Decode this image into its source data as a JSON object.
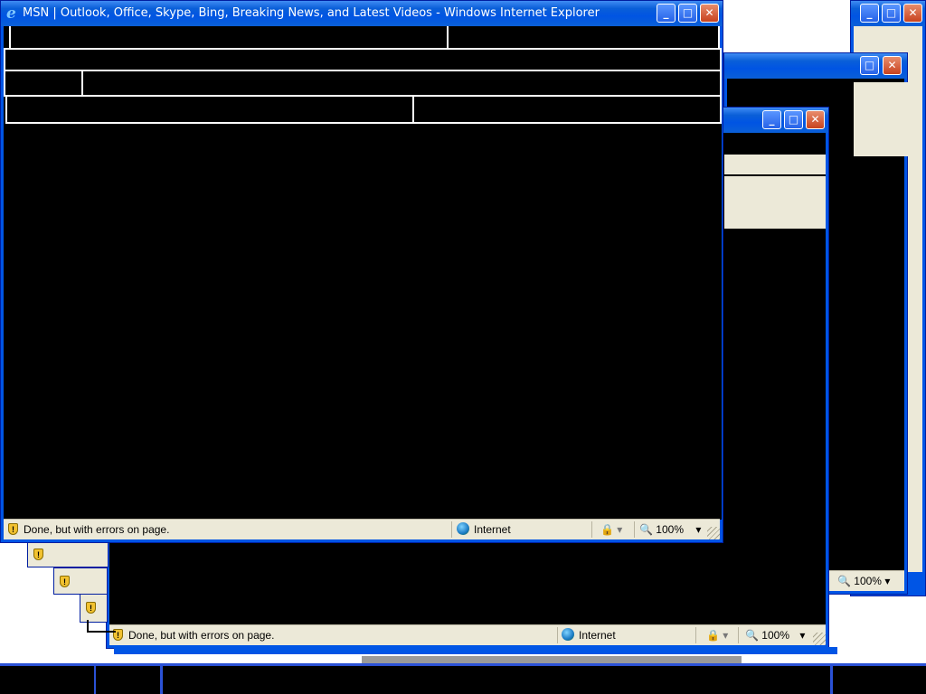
{
  "main_window": {
    "title": "MSN | Outlook, Office, Skype, Bing, Breaking News, and Latest Videos - Windows Internet Explorer",
    "buttons": {
      "minimize": "_",
      "maximize": "□",
      "close": "✕"
    },
    "status": {
      "message": "Done, but with errors on page.",
      "zone": "Internet",
      "zoom": "100%",
      "dropdown_arrow": "▾"
    }
  },
  "second_window": {
    "status": {
      "message": "Done, but with errors on page.",
      "zone": "Internet",
      "zoom": "100%",
      "dropdown_arrow": "▾"
    }
  },
  "back_window": {
    "status": {
      "zoom": "100%",
      "dropdown_arrow": "▾"
    }
  },
  "icons": {
    "ie_logo": "ie-logo-icon",
    "shield": "shield-warning-icon",
    "globe": "globe-icon",
    "protected": "protected-mode-icon",
    "zoom": "magnifier-icon"
  },
  "colors": {
    "titlebar": "#0054e3",
    "close_button": "#c8431f",
    "statusbar": "#ece9d8",
    "content": "#000000"
  }
}
